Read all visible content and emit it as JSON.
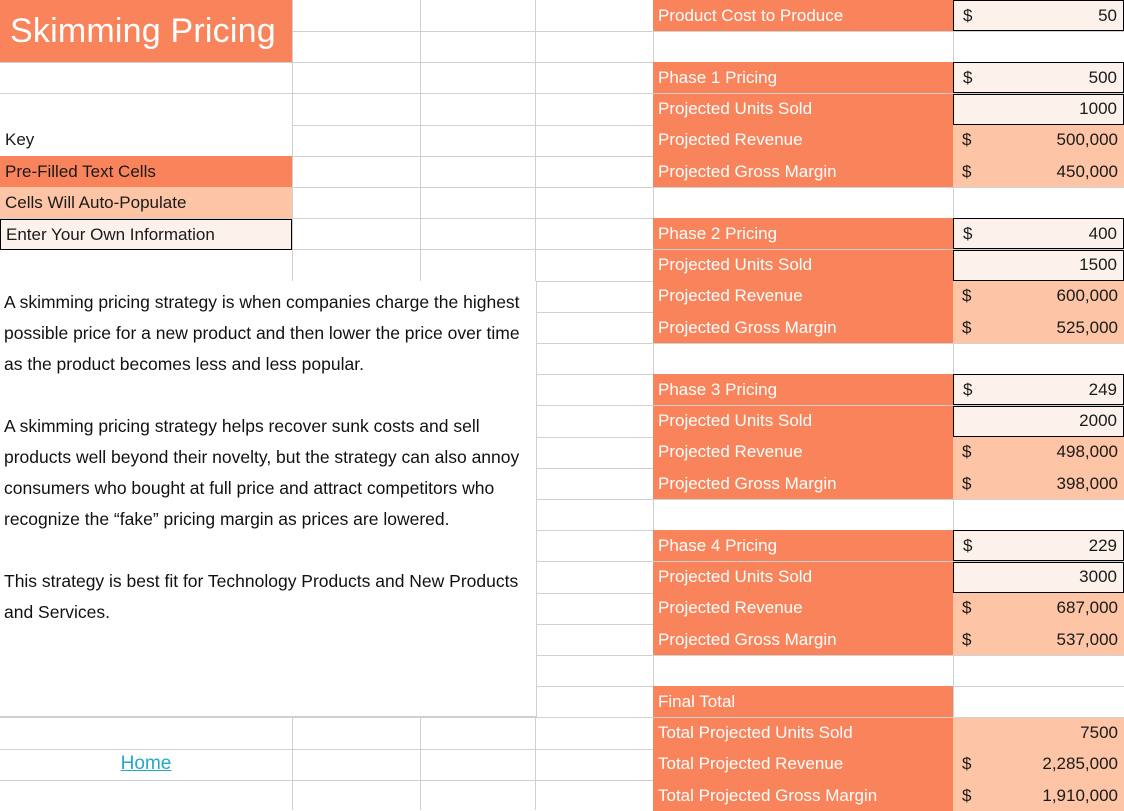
{
  "title": "Skimming Pricing",
  "key": {
    "heading": "Key",
    "prefilled": "Pre-Filled Text Cells",
    "autopopulate": "Cells Will Auto-Populate",
    "userinput": "Enter Your Own Information"
  },
  "narrative": {
    "p1": "A skimming pricing strategy is when companies charge the highest possible price for a new product and then lower the price over time as the product becomes less and less popular.",
    "p2": "A skimming pricing strategy helps recover sunk costs and sell products well beyond their novelty, but the strategy can also annoy consumers who bought at full price and attract competitors who recognize the “fake” pricing margin as prices are lowered.",
    "p3": "This strategy is best fit for Technology Products and New Products and Services."
  },
  "home_link": "Home",
  "colors": {
    "header_orange": "#f9845b",
    "auto_populate": "#fdc5a6",
    "input_cell": "#fdf1ec",
    "link_teal": "#22a8c9",
    "header_text": "#ffffff"
  },
  "table": {
    "cost": {
      "label": "Product Cost to Produce",
      "currency": "$",
      "value": "50"
    },
    "phases": [
      {
        "price_label": "Phase 1 Pricing",
        "price_currency": "$",
        "price_value": "500",
        "units_label": "Projected Units Sold",
        "units_value": "1000",
        "revenue_label": "Projected Revenue",
        "revenue_currency": "$",
        "revenue_value": "500,000",
        "margin_label": "Projected Gross Margin",
        "margin_currency": "$",
        "margin_value": "450,000"
      },
      {
        "price_label": "Phase 2 Pricing",
        "price_currency": "$",
        "price_value": "400",
        "units_label": "Projected Units Sold",
        "units_value": "1500",
        "revenue_label": "Projected Revenue",
        "revenue_currency": "$",
        "revenue_value": "600,000",
        "margin_label": "Projected Gross Margin",
        "margin_currency": "$",
        "margin_value": "525,000"
      },
      {
        "price_label": "Phase 3 Pricing",
        "price_currency": "$",
        "price_value": "249",
        "units_label": "Projected Units Sold",
        "units_value": "2000",
        "revenue_label": "Projected Revenue",
        "revenue_currency": "$",
        "revenue_value": "498,000",
        "margin_label": "Projected Gross Margin",
        "margin_currency": "$",
        "margin_value": "398,000"
      },
      {
        "price_label": "Phase 4 Pricing",
        "price_currency": "$",
        "price_value": "229",
        "units_label": "Projected Units Sold",
        "units_value": "3000",
        "revenue_label": "Projected Revenue",
        "revenue_currency": "$",
        "revenue_value": "687,000",
        "margin_label": "Projected Gross Margin",
        "margin_currency": "$",
        "margin_value": "537,000"
      }
    ],
    "final": {
      "heading": "Final Total",
      "units_label": "Total Projected Units Sold",
      "units_value": "7500",
      "revenue_label": "Total Projected Revenue",
      "revenue_currency": "$",
      "revenue_value": "2,285,000",
      "margin_label": "Total Projected Gross Margin",
      "margin_currency": "$",
      "margin_value": "1,910,000"
    }
  }
}
